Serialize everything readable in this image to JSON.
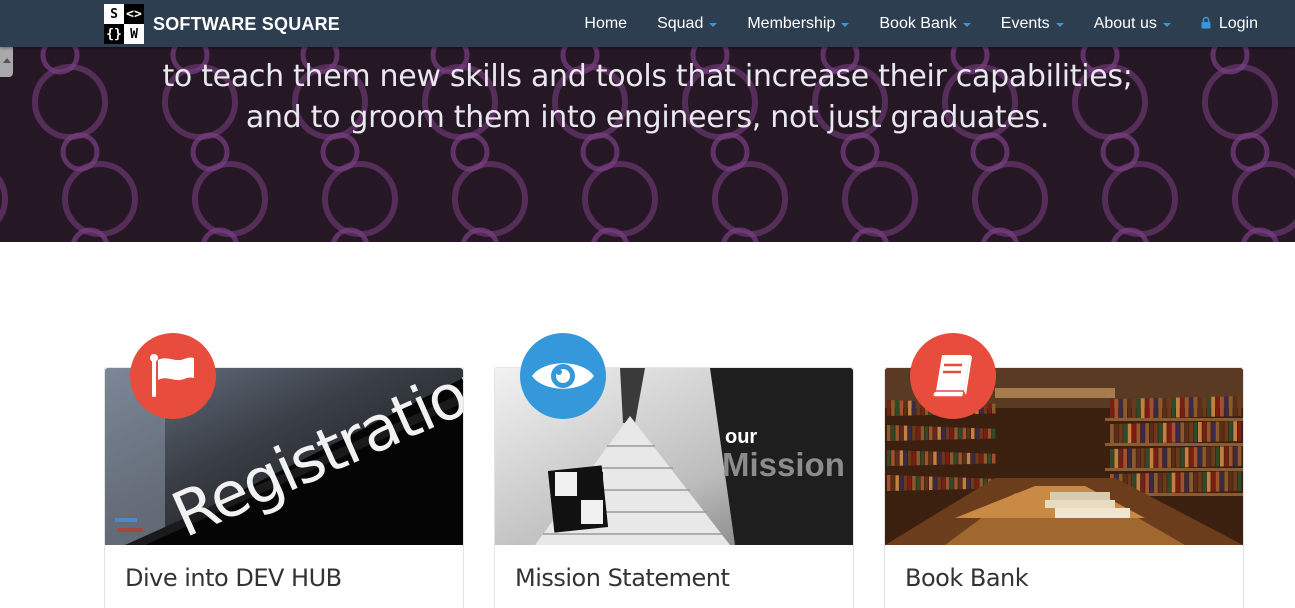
{
  "brand": {
    "name": "SOFTWARE SQUARE",
    "logo_glyphs": [
      "S",
      "<>",
      "{}",
      "W"
    ]
  },
  "nav": {
    "items": [
      {
        "label": "Home",
        "dropdown": false
      },
      {
        "label": "Squad",
        "dropdown": true
      },
      {
        "label": "Membership",
        "dropdown": true
      },
      {
        "label": "Book Bank",
        "dropdown": true
      },
      {
        "label": "Events",
        "dropdown": true
      },
      {
        "label": "About us",
        "dropdown": true
      }
    ],
    "login_label": "Login",
    "login_icon": "lock-icon"
  },
  "hero": {
    "lines": [
      "to teach them new skills and tools that increase their capabilities;",
      "and to groom them into engineers, not just graduates."
    ]
  },
  "cards": [
    {
      "title": "Dive into DEV HUB",
      "image": "registration-image",
      "badge_icon": "flag-icon",
      "image_text": "Registration"
    },
    {
      "title": "Mission Statement",
      "image": "mission-image",
      "badge_icon": "eye-icon",
      "image_text_small": "our",
      "image_text_large": "Mission"
    },
    {
      "title": "Book Bank",
      "image": "library-image",
      "badge_icon": "book-icon"
    }
  ],
  "colors": {
    "navbar": "#2c3e50",
    "accent": "#3498db",
    "badge_red": "#e74c3c",
    "hero_bg": "#261724",
    "hero_ring": "#7a3f84"
  }
}
